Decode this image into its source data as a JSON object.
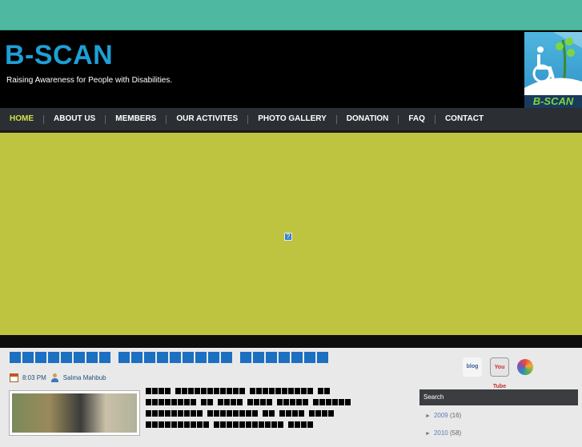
{
  "header": {
    "title": "B-SCAN",
    "description": "Raising Awareness for People with Disabilities.",
    "logo_text": "B-SCAN"
  },
  "nav": {
    "items": [
      {
        "label": "HOME",
        "active": true
      },
      {
        "label": "ABOUT US"
      },
      {
        "label": "MEMBERS"
      },
      {
        "label": "OUR ACTIVITES"
      },
      {
        "label": "PHOTO GALLERY"
      },
      {
        "label": "DONATION"
      },
      {
        "label": "FAQ"
      },
      {
        "label": "CONTACT"
      }
    ]
  },
  "post": {
    "time": "8:03 PM",
    "author": "Salma Mahbub"
  },
  "sidebar": {
    "search_label": "Search",
    "archive": [
      {
        "year": "2009",
        "count": "(16)"
      },
      {
        "year": "2010",
        "count": "(58)"
      }
    ]
  },
  "social": {
    "blog": "blog",
    "youtube": "You Tube"
  },
  "colors": {
    "topbar": "#4fb8a0",
    "title": "#1e9fd6",
    "banner": "#bec43f",
    "nav_active": "#d4e04a",
    "post_title_glyph": "#1d6fc2"
  }
}
